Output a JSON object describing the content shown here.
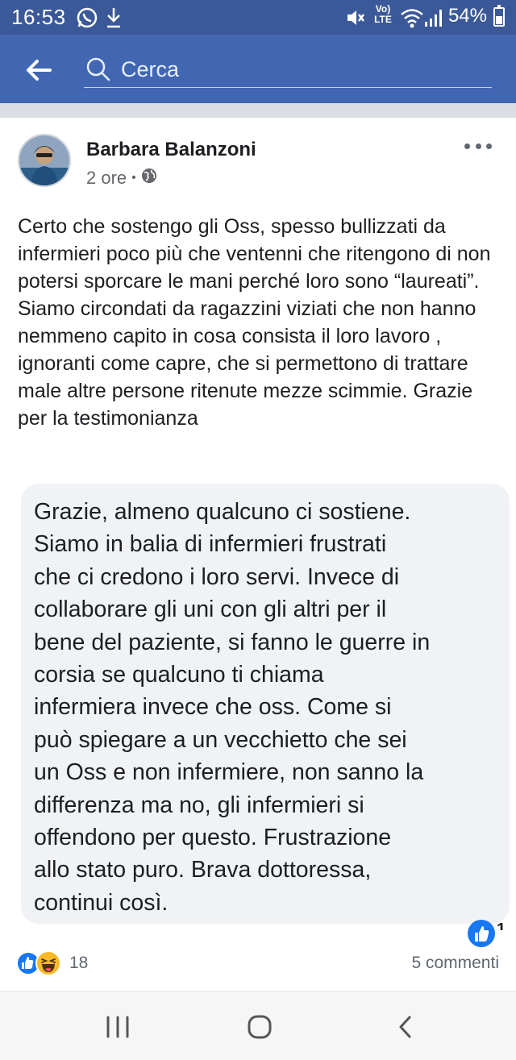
{
  "status_bar": {
    "time": "16:53",
    "battery_percent": "54%",
    "battery_level": 0.54,
    "lte_top": "Vo)",
    "lte_bottom": "LTE"
  },
  "header": {
    "search_placeholder": "Cerca"
  },
  "post": {
    "author": "Barbara Balanzoni",
    "time": "2 ore",
    "privacy_icon": "globe-icon",
    "text": "Certo che sostengo gli Oss, spesso bullizzati da infermieri poco più che ventenni che ritengono di non potersi sporcare le mani perché loro sono “laureati”. Siamo circondati da ragazzini viziati che non hanno nemmeno capito in cosa consista il loro lavoro , ignoranti come capre, che si permettono di trattare male altre persone ritenute mezze scimmie. Grazie per la testimonianza",
    "comment_lines": [
      "Grazie,  almeno qualcuno ci sostiene.",
      "Siamo in balia di infermieri frustrati",
      "che ci credono i loro servi. Invece di",
      "collaborare gli uni con gli altri per il",
      "bene del paziente, si fanno le guerre in",
      "corsia se qualcuno ti chiama",
      "infermiera invece che oss. Come si",
      "può spiegare a un vecchietto che sei",
      "un Oss e non infermiere, non sanno la",
      "differenza ma no, gli infermieri si",
      "offendono per questo. Frustrazione",
      "allo stato puro. Brava dottoressa,",
      "continui così."
    ],
    "comment_reaction_count": "1",
    "reactions_count": "18",
    "comments_count": "5 commenti"
  },
  "colors": {
    "status_bar": "#3b5998",
    "header": "#4267b2",
    "like_blue": "#1877f2",
    "haha_yellow": "#f7b928",
    "comment_bg": "#f0f2f5"
  }
}
